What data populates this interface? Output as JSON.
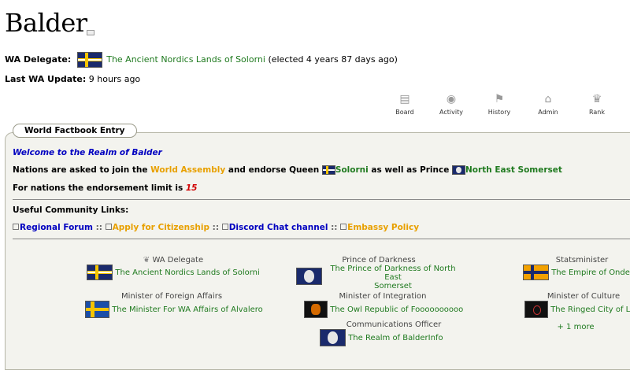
{
  "region": {
    "name": "Balder"
  },
  "delegate": {
    "label": "WA Delegate:",
    "nation": "The Ancient Nordics Lands of Solorni",
    "note": "(elected 4 years 87 days ago)"
  },
  "last_update": {
    "label": "Last WA Update:",
    "value": "9 hours ago"
  },
  "toolbar": [
    {
      "label": "Board",
      "icon": "board-icon"
    },
    {
      "label": "Activity",
      "icon": "activity-icon"
    },
    {
      "label": "History",
      "icon": "history-icon"
    },
    {
      "label": "Admin",
      "icon": "admin-icon"
    },
    {
      "label": "Rank",
      "icon": "rank-icon"
    }
  ],
  "factbook": {
    "legend": "World Factbook Entry",
    "welcome": "Welcome to the Realm of Balder",
    "join_pre": "Nations are asked to join the",
    "join_link": "World Assembly",
    "join_mid": "and endorse Queen",
    "queen": "Solorni",
    "join_mid2": "as well as Prince",
    "prince": "North East Somerset",
    "limit_text": "For nations the endorsement limit is",
    "limit_value": "15",
    "useful_heading": "Useful Community Links:",
    "links": [
      {
        "label": "Regional Forum",
        "color": "#0000c0"
      },
      {
        "label": "Apply for Citizenship",
        "color": "#e8a000"
      },
      {
        "label": "Discord Chat channel",
        "color": "#0000c0"
      },
      {
        "label": "Embassy Policy",
        "color": "#e8a000"
      }
    ],
    "separator": "::"
  },
  "officers": [
    {
      "role": "WA Delegate",
      "nation": "The Ancient Nordics Lands of Solorni",
      "flag": "nordic"
    },
    {
      "role": "Prince of Darkness",
      "nation": "The Prince of Darkness of North East",
      "nation2": "Somerset",
      "flag": "seal"
    },
    {
      "role": "Statsminister",
      "nation": "The Empire of Onder",
      "flag": "orange"
    },
    {
      "role": "Minister of Foreign Affairs",
      "nation": "The Minister For WA Affairs of Alvalero",
      "flag": "alva"
    },
    {
      "role": "Minister of Integration",
      "nation": "The Owl Republic of Foooooooooo",
      "flag": "owl"
    },
    {
      "role": "Minister of Culture",
      "nation": "The Ringed City of Lo",
      "flag": "dark"
    },
    {
      "role": "Communications Officer",
      "nation": "The Realm of BalderInfo",
      "flag": "seal"
    }
  ],
  "more": "+ 1 more"
}
